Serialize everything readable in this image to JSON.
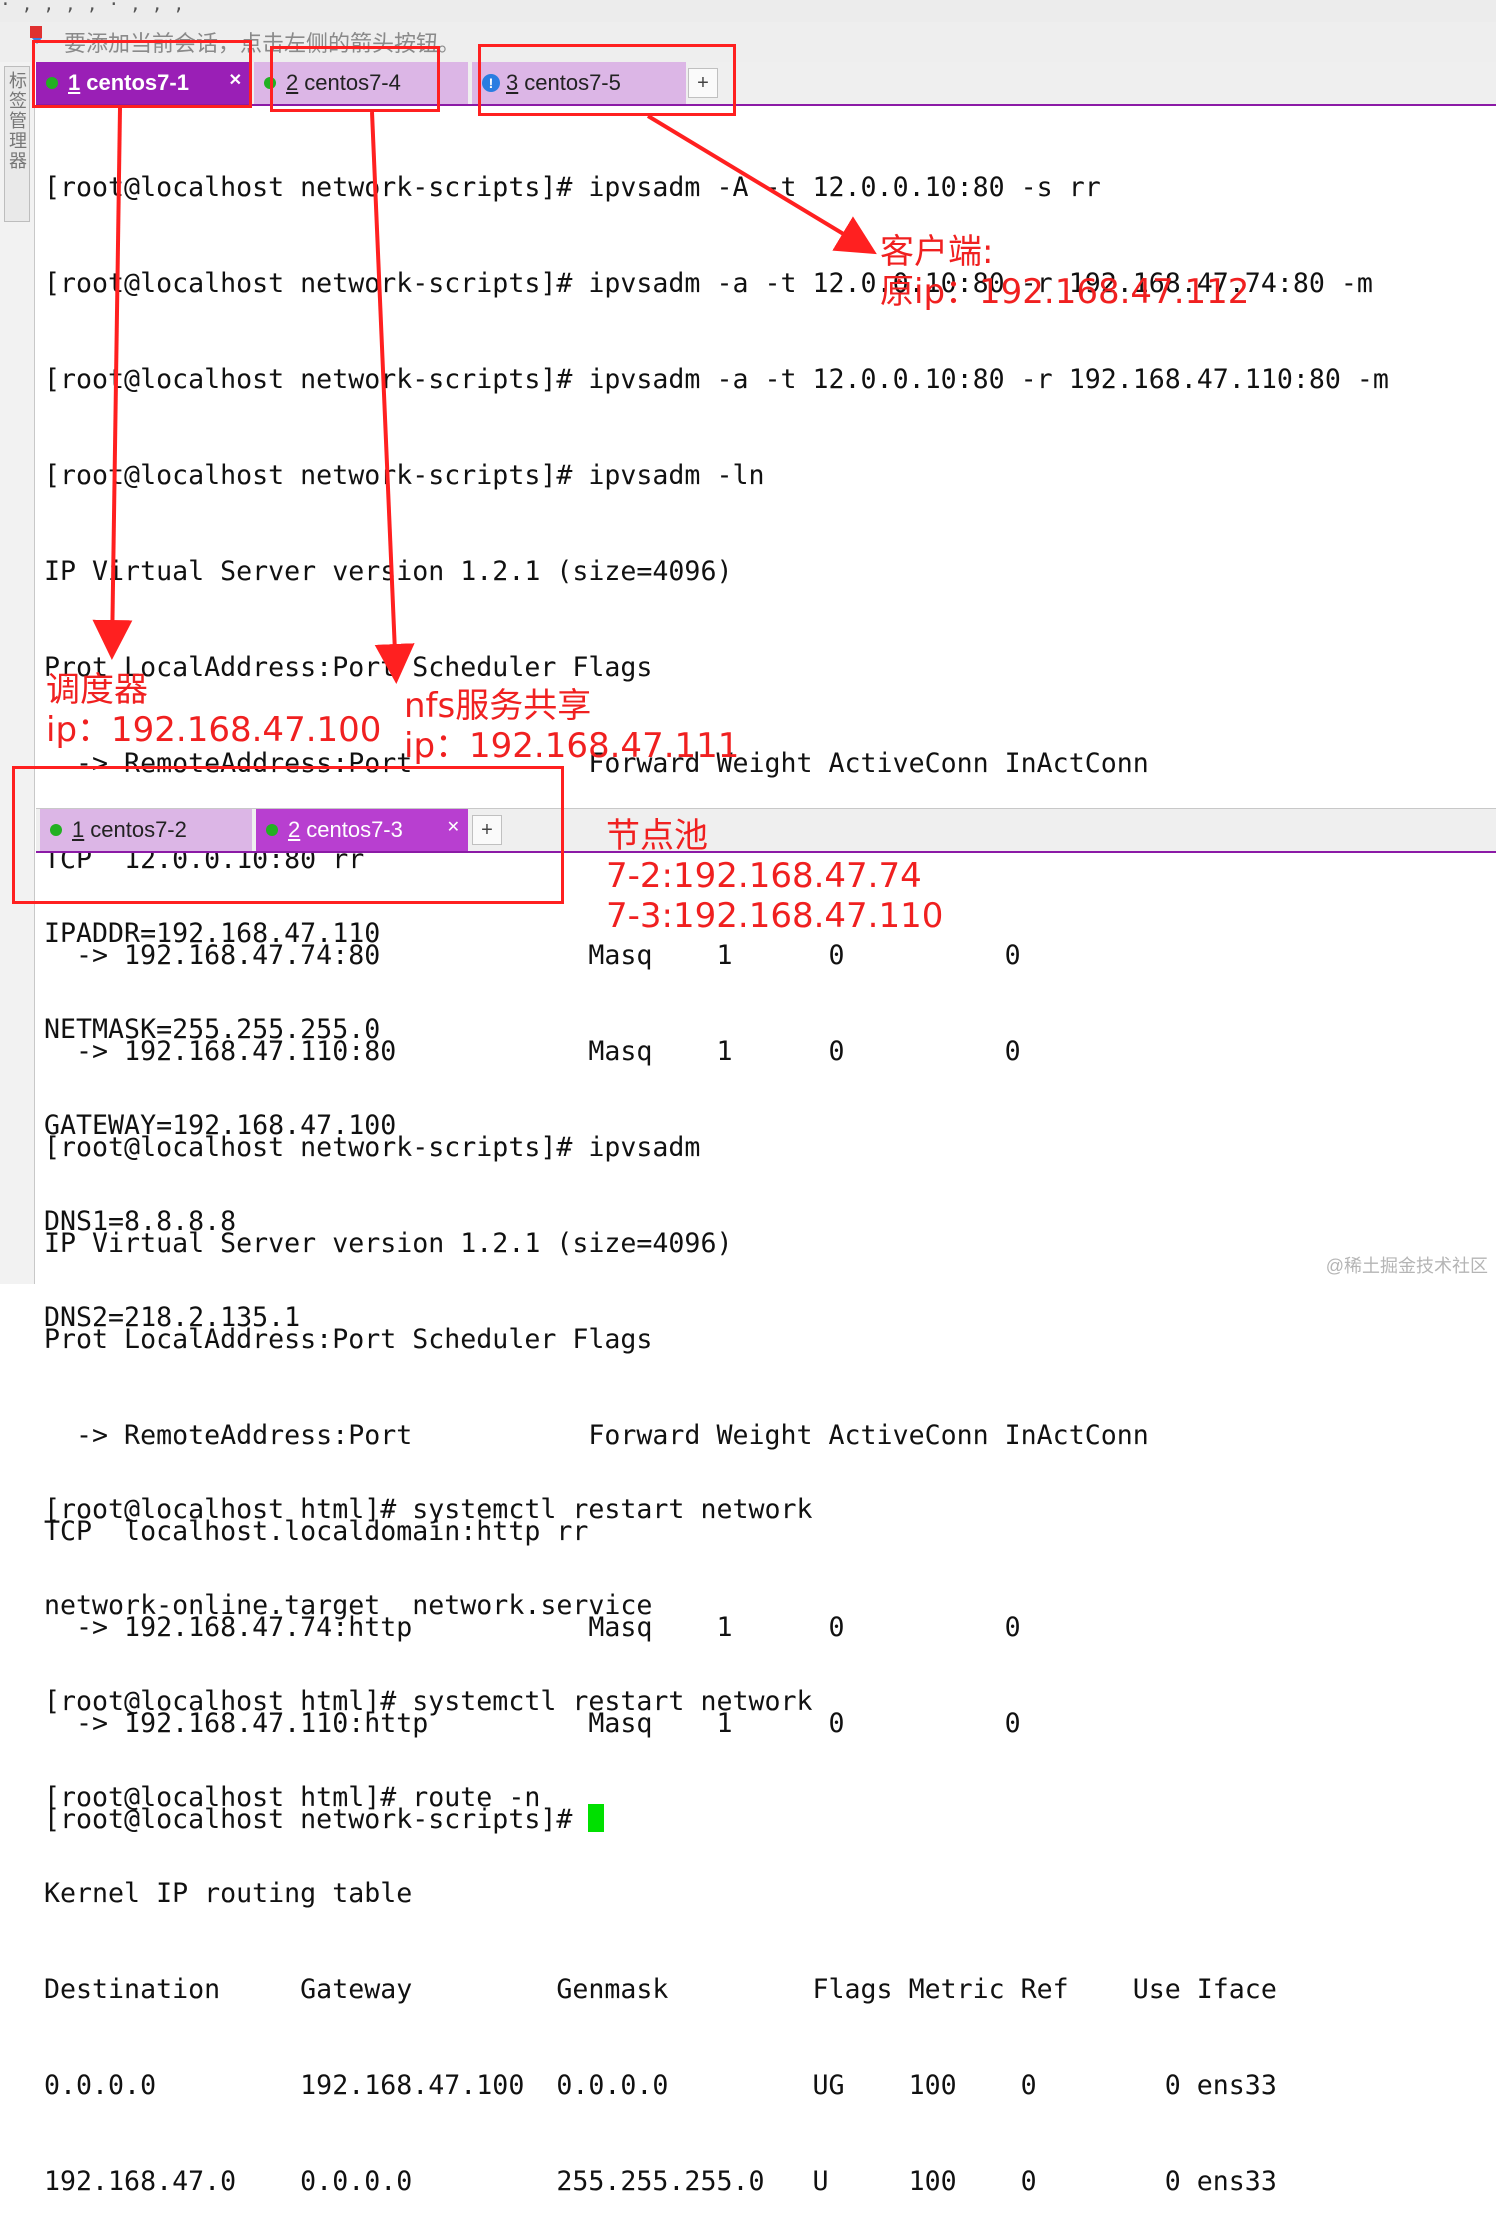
{
  "top_strip_text": "   ·   ,   ,   ,   ,   ·   ,   ,   ,   ",
  "hint": {
    "text": "要添加当前会话，点击左侧的箭头按钮。"
  },
  "side_panel": {
    "label": "标签管理器"
  },
  "top_tabs": [
    {
      "number": "1",
      "label": "centos7-1",
      "status": "connected",
      "active": true
    },
    {
      "number": "2",
      "label": "centos7-4",
      "status": "connected",
      "active": false
    },
    {
      "number": "3",
      "label": "centos7-5",
      "status": "warning",
      "active": false
    }
  ],
  "bottom_tabs": [
    {
      "number": "1",
      "label": "centos7-2",
      "status": "connected",
      "active": false
    },
    {
      "number": "2",
      "label": "centos7-3",
      "status": "connected",
      "active": true
    }
  ],
  "top_terminal": [
    "[root@localhost network-scripts]# ipvsadm -A -t 12.0.0.10:80 -s rr",
    "[root@localhost network-scripts]# ipvsadm -a -t 12.0.0.10:80 -r 192.168.47.74:80 -m",
    "[root@localhost network-scripts]# ipvsadm -a -t 12.0.0.10:80 -r 192.168.47.110:80 -m",
    "[root@localhost network-scripts]# ipvsadm -ln",
    "IP Virtual Server version 1.2.1 (size=4096)",
    "Prot LocalAddress:Port Scheduler Flags",
    "  -> RemoteAddress:Port           Forward Weight ActiveConn InActConn",
    "TCP  12.0.0.10:80 rr",
    "  -> 192.168.47.74:80             Masq    1      0          0",
    "  -> 192.168.47.110:80            Masq    1      0          0",
    "[root@localhost network-scripts]# ipvsadm",
    "IP Virtual Server version 1.2.1 (size=4096)",
    "Prot LocalAddress:Port Scheduler Flags",
    "  -> RemoteAddress:Port           Forward Weight ActiveConn InActConn",
    "TCP  localhost.localdomain:http rr",
    "  -> 192.168.47.74:http           Masq    1      0          0",
    "  -> 192.168.47.110:http          Masq    1      0          0"
  ],
  "top_prompt": "[root@localhost network-scripts]# ",
  "bottom_terminal": [
    "IPADDR=192.168.47.110",
    "NETMASK=255.255.255.0",
    "GATEWAY=192.168.47.100",
    "DNS1=8.8.8.8",
    "DNS2=218.2.135.1",
    "",
    "[root@localhost html]# systemctl restart network",
    "network-online.target  network.service",
    "[root@localhost html]# systemctl restart network",
    "[root@localhost html]# route -n",
    "Kernel IP routing table",
    "Destination     Gateway         Genmask         Flags Metric Ref    Use Iface",
    "0.0.0.0         192.168.47.100  0.0.0.0         UG    100    0        0 ens33",
    "192.168.47.0    0.0.0.0         255.255.255.0   U     100    0        0 ens33"
  ],
  "annotations": {
    "client": "客户端:\n原ip：192.168.47.112",
    "scheduler": "调度器\nip：192.168.47.100",
    "nfs": "nfs服务共享\nip：192.168.47.111",
    "node_pool": "节点池\n7-2:192.168.47.74\n7-3:192.168.47.110"
  },
  "watermark": "@稀土掘金技术社区",
  "colors": {
    "active_tab": "#9a1fb6",
    "inactive_tab": "#dcb6e6",
    "annotation_red": "#f02020",
    "cursor": "#00e000"
  }
}
